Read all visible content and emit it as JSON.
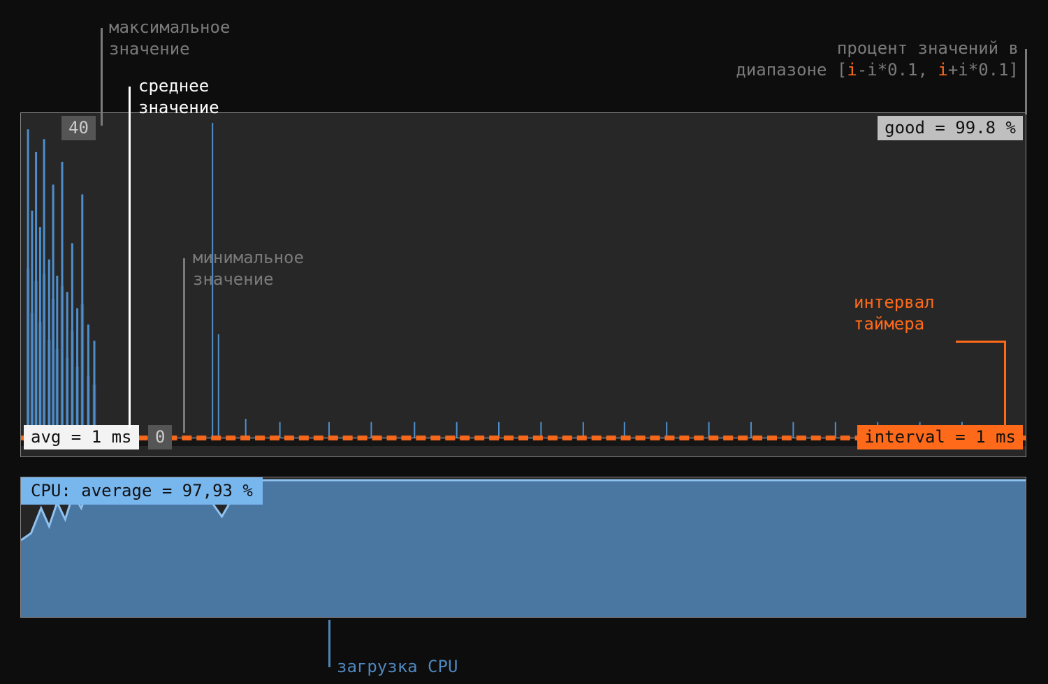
{
  "labels": {
    "max_value_1": "максимальное",
    "max_value_2": "значение",
    "avg_value_1": "среднее",
    "avg_value_2": "значение",
    "min_value_1": "минимальное",
    "min_value_2": "значение",
    "good_pct_1": "процент значений в",
    "good_pct_2_pre": "диапазоне [",
    "good_pct_2_i1": "i",
    "good_pct_2_mid1": "-i*0.1, ",
    "good_pct_2_i2": "i",
    "good_pct_2_mid2": "+i*0.1]",
    "interval_1": "интервал",
    "interval_2": "таймера",
    "cpu_load": "загрузка CPU"
  },
  "chips": {
    "max": "40",
    "good": "good = 99.8 %",
    "min": "0",
    "avg": "avg = 1 ms",
    "interval": "interval = 1 ms",
    "cpu": "CPU: average = 97,93 %"
  },
  "chart_data": [
    {
      "type": "line",
      "title": "Timer latency",
      "ylabel": "ms",
      "ylim": [
        0,
        40
      ],
      "baseline_y": 1,
      "interval_ms": 1,
      "avg_ms": 1,
      "max_ms": 40,
      "min_ms": 0,
      "good_pct": 99.8,
      "spikes_x_fraction": [
        0.006,
        0.01,
        0.014,
        0.018,
        0.022,
        0.027,
        0.031,
        0.035,
        0.04,
        0.045,
        0.05,
        0.055,
        0.06,
        0.066,
        0.072,
        0.19,
        0.196,
        0.223,
        0.257,
        0.306,
        0.348,
        0.391,
        0.433,
        0.475,
        0.517,
        0.559,
        0.6,
        0.642,
        0.684,
        0.726,
        0.768,
        0.81,
        0.852,
        0.894,
        0.936
      ],
      "spikes_height_fraction": [
        0.95,
        0.7,
        0.88,
        0.65,
        0.92,
        0.55,
        0.78,
        0.5,
        0.85,
        0.45,
        0.6,
        0.4,
        0.75,
        0.35,
        0.3,
        0.97,
        0.32,
        0.06,
        0.05,
        0.05,
        0.05,
        0.05,
        0.05,
        0.05,
        0.05,
        0.05,
        0.05,
        0.05,
        0.05,
        0.05,
        0.05,
        0.05,
        0.05,
        0.05,
        0.05
      ]
    },
    {
      "type": "area",
      "title": "CPU load",
      "ylabel": "%",
      "ylim": [
        0,
        100
      ],
      "avg_pct": 97.93,
      "x_fraction": [
        0.0,
        0.01,
        0.02,
        0.028,
        0.036,
        0.044,
        0.052,
        0.06,
        0.068,
        0.078,
        0.09,
        0.11,
        0.15,
        0.185,
        0.192,
        0.2,
        0.208,
        0.216,
        0.224,
        0.26,
        0.32,
        0.4,
        0.5,
        0.6,
        0.7,
        0.8,
        0.9,
        1.0
      ],
      "y_pct": [
        55,
        60,
        78,
        65,
        82,
        70,
        88,
        78,
        94,
        97,
        98,
        98,
        98,
        98,
        80,
        72,
        82,
        94,
        98,
        98,
        98,
        98,
        98,
        98,
        98,
        98,
        98,
        98
      ]
    }
  ]
}
